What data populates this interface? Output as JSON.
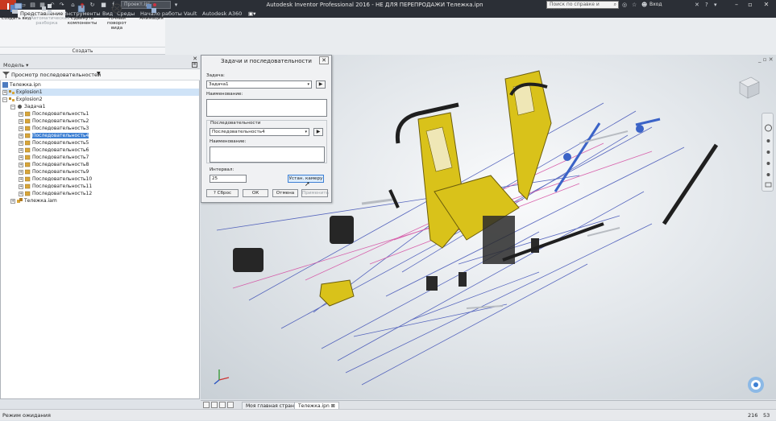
{
  "titlebar": {
    "logo_letter": "I",
    "logo_sub": "PRO",
    "project_label": "Проект.ipj",
    "app_title": "Autodesk Inventor Professional 2016 - НЕ ДЛЯ ПЕРЕПРОДАЖИ   Тележка.ipn",
    "help_placeholder": "Поиск по справке и командам",
    "signin": "Вход",
    "help_icon": "help-icon"
  },
  "tabs": [
    "Представление",
    "Инструменты",
    "Вид",
    "Среды",
    "Начало работы",
    "Vault",
    "Autodesk A360"
  ],
  "ribbon": {
    "buttons": [
      {
        "label": "Создать вид",
        "icon": "create-view-icon"
      },
      {
        "label": "Автоматическая разборка",
        "icon": "auto-explode-icon"
      },
      {
        "label": "Сдвинуть компоненты",
        "icon": "tweak-components-icon"
      },
      {
        "label": "Точный поворот вида",
        "icon": "precise-rotate-icon"
      },
      {
        "label": "Анимация",
        "icon": "animation-icon"
      }
    ],
    "group_label": "Создать"
  },
  "browser": {
    "header": "Модель ▾",
    "view_selector": "Просмотр последовательностей",
    "tree": [
      {
        "label": "Тележка.ipn",
        "level": 0
      },
      {
        "label": "Explosion1",
        "level": 0,
        "selected": true
      },
      {
        "label": "Explosion2",
        "level": 0
      },
      {
        "label": "Задача1",
        "level": 1
      },
      {
        "label": "Последовательность1",
        "level": 2
      },
      {
        "label": "Последовательность2",
        "level": 2
      },
      {
        "label": "Последовательность3",
        "level": 2
      },
      {
        "label": "Последовательность4",
        "level": 2,
        "highlighted": true
      },
      {
        "label": "Последовательность5",
        "level": 2
      },
      {
        "label": "Последовательность6",
        "level": 2
      },
      {
        "label": "Последовательность7",
        "level": 2
      },
      {
        "label": "Последовательность8",
        "level": 2
      },
      {
        "label": "Последовательность9",
        "level": 2
      },
      {
        "label": "Последовательность10",
        "level": 2
      },
      {
        "label": "Последовательность11",
        "level": 2
      },
      {
        "label": "Последовательность12",
        "level": 2
      },
      {
        "label": "Тележка.iam",
        "level": 1
      }
    ]
  },
  "dialog": {
    "title": "Задачи и последовательности",
    "task_label": "Задача:",
    "task_value": "Задача1",
    "name_label": "Наименование:",
    "name_value": "",
    "sequences_label": "Последовательности",
    "sequence_value": "Последовательность4",
    "seq_name_label": "Наименование:",
    "seq_name_value": "",
    "interval_label": "Интервал:",
    "interval_value": "25",
    "set_camera": "Устан. камеру",
    "reset": "Сброс",
    "ok": "ОК",
    "cancel": "Отмена",
    "apply": "Применить"
  },
  "document_tabs": [
    "Моя главная стран...",
    "Тележка.ipn"
  ],
  "statusbar": {
    "text": "Режим ожидания",
    "count1": "216",
    "count2": "53"
  },
  "colors": {
    "accent": "#3c7fd3",
    "brand": "#c8381f",
    "part_yellow": "#d9c21a",
    "trail_blue": "#3d4fb5",
    "trail_pink": "#d44aa0"
  }
}
